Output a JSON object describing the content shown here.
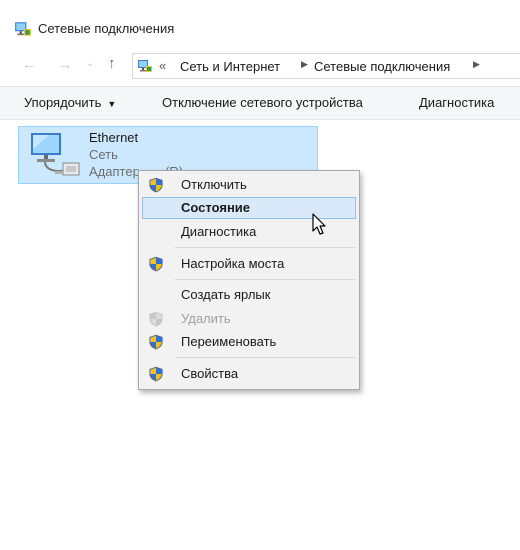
{
  "window": {
    "title": "Сетевые подключения"
  },
  "nav": {
    "back_icon": "back-arrow-icon",
    "forward_icon": "forward-arrow-icon",
    "up_icon": "up-arrow-icon",
    "overflow_label": "«",
    "breadcrumb": [
      "Сеть и Интернет",
      "Сетевые подключения"
    ]
  },
  "toolbar": {
    "organize_label": "Упорядочить",
    "disconnect_label": "Отключение сетевого устройства",
    "diagnostics_label": "Диагностика"
  },
  "connection": {
    "name": "Ethernet",
    "network": "Сеть",
    "adapter": "Адаптер...          ...(R)",
    "icon": "ethernet-adapter-icon"
  },
  "context_menu": {
    "items": [
      {
        "label": "Отключить",
        "icon": "uac-shield-icon"
      },
      {
        "label": "Состояние",
        "icon": "",
        "bold": true,
        "highlighted": true
      },
      {
        "label": "Диагностика",
        "icon": ""
      },
      {
        "label": "Настройка моста",
        "icon": "uac-shield-icon"
      },
      {
        "label": "Создать ярлык",
        "icon": ""
      },
      {
        "label": "Удалить",
        "icon": "uac-shield-icon",
        "disabled": true
      },
      {
        "label": "Переименовать",
        "icon": "uac-shield-icon"
      },
      {
        "label": "Свойства",
        "icon": "uac-shield-icon"
      }
    ]
  },
  "colors": {
    "selection_bg": "#cce8ff",
    "selection_border": "#99d1ff",
    "menu_bg": "#f2f2f2",
    "menu_highlight": "#d9e9f9",
    "disabled_text": "#a0a0a0"
  }
}
